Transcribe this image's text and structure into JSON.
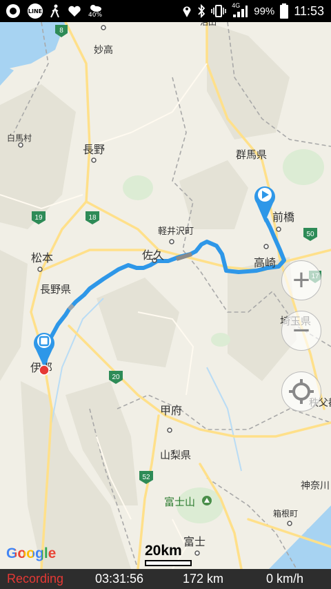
{
  "status_bar": {
    "icons": [
      "record-icon",
      "line-app-icon",
      "walking-icon",
      "heart-icon",
      "weather-icon",
      "location-icon",
      "bluetooth-icon",
      "vibrate-icon",
      "signal-icon",
      "battery-icon"
    ],
    "line_label": "LINE",
    "weather_percent": "40%",
    "network": "4G",
    "battery": "99%",
    "time": "11:53"
  },
  "map": {
    "place_labels": {
      "myoko": "妙高",
      "hakuba": "白馬村",
      "nagano": "長野",
      "gunma": "群馬県",
      "maebashi": "前橋",
      "karuizawa": "軽井沢町",
      "saku": "佐久",
      "takasaki": "高崎",
      "matsumoto": "松本",
      "nagano_pref": "長野県",
      "ina": "伊那",
      "saitama": "埼玉県",
      "kofu": "甲府",
      "yamanashi": "山梨県",
      "fujisan": "富士山",
      "kanagawa": "神奈川",
      "hakone": "箱根町",
      "fuji": "富士",
      "numata": "沼田",
      "chichibu": "秩父都"
    },
    "road_shields": [
      "8",
      "19",
      "18",
      "50",
      "17",
      "20",
      "52"
    ],
    "attribution": "Google",
    "scale": "20km",
    "zoom_in": "+",
    "zoom_out": "−",
    "accent_color": "#2e97e8"
  },
  "bottom_bar": {
    "status": "Recording",
    "elapsed": "03:31:56",
    "distance": "172 km",
    "speed": "0 km/h",
    "status_color": "#e53935"
  }
}
